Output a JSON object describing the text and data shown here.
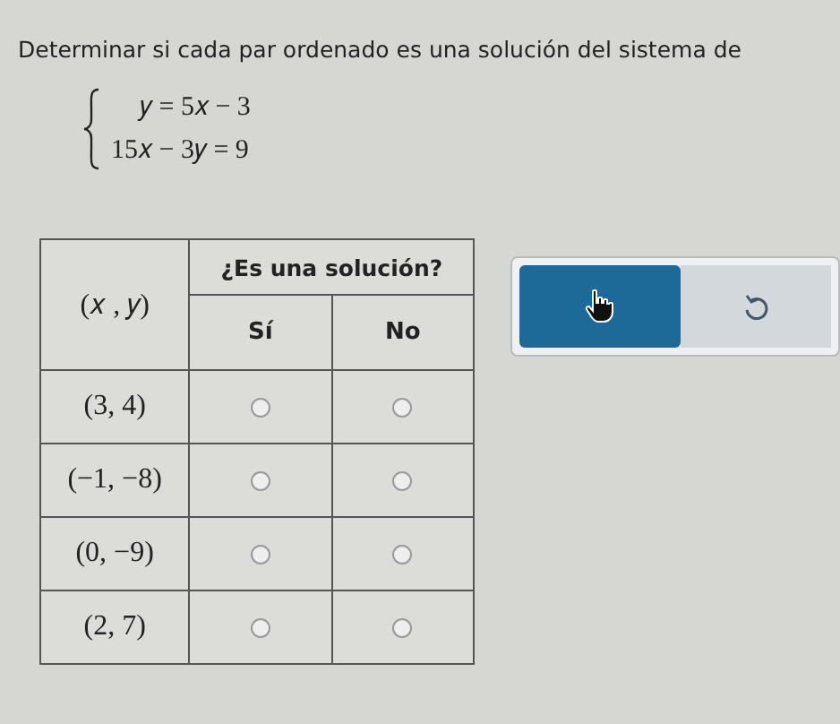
{
  "instruction": "Determinar si cada par ordenado es una solución del sistema de",
  "system": [
    "𝑦 = 5𝑥 − 3",
    "15𝑥 − 3𝑦 = 9"
  ],
  "table": {
    "pair_heading": "(𝑥 , 𝑦)",
    "group_heading": "¿Es una solución?",
    "options": [
      "Sí",
      "No"
    ],
    "rows": [
      {
        "pair": "(3, 4)",
        "choices": [
          {
            "selected": false
          },
          {
            "selected": false
          }
        ]
      },
      {
        "pair": "(−1, −8)",
        "choices": [
          {
            "selected": false
          },
          {
            "selected": false
          }
        ]
      },
      {
        "pair": "(0, −9)",
        "choices": [
          {
            "selected": false
          },
          {
            "selected": false
          }
        ]
      },
      {
        "pair": "(2, 7)",
        "choices": [
          {
            "selected": false
          },
          {
            "selected": false
          }
        ]
      }
    ]
  }
}
